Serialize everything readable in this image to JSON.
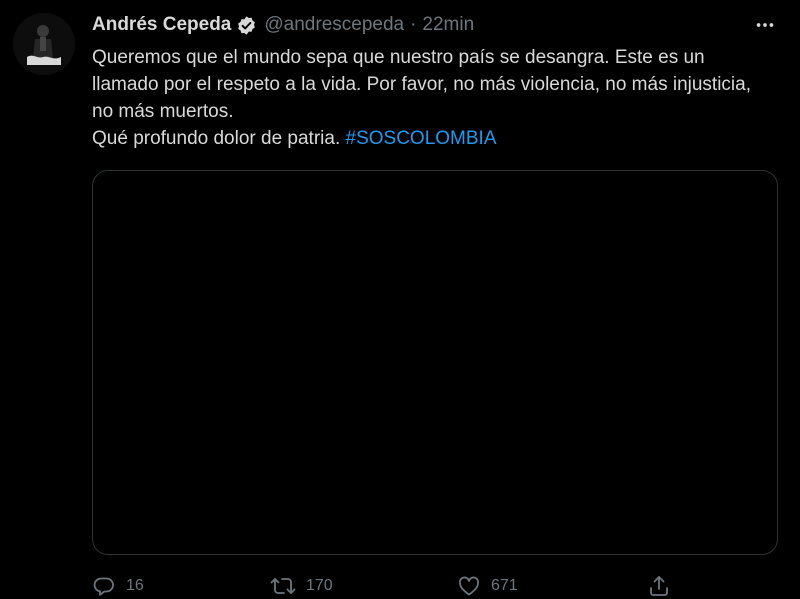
{
  "tweet": {
    "author_name": "Andrés Cepeda",
    "handle": "@andrescepeda",
    "separator": "·",
    "time": "22min",
    "text_line1": "Queremos que el mundo sepa que nuestro país se desangra. Este es un llamado por el respeto a la vida. Por favor, no más violencia, no más injusticia, no más muertos.",
    "text_line2": "Qué profundo dolor de patria. ",
    "hashtag": "#SOSCOLOMBIA"
  },
  "actions": {
    "reply_count": "16",
    "retweet_count": "170",
    "like_count": "671"
  },
  "icons": {
    "verified": "verified-badge-icon",
    "more": "more-horizontal-icon",
    "reply": "reply-icon",
    "retweet": "retweet-icon",
    "like": "heart-icon",
    "share": "share-icon"
  },
  "colors": {
    "background": "#000000",
    "text": "#d9d9d9",
    "muted": "#6e767d",
    "link": "#1d9bf0",
    "border": "#2f3336"
  }
}
